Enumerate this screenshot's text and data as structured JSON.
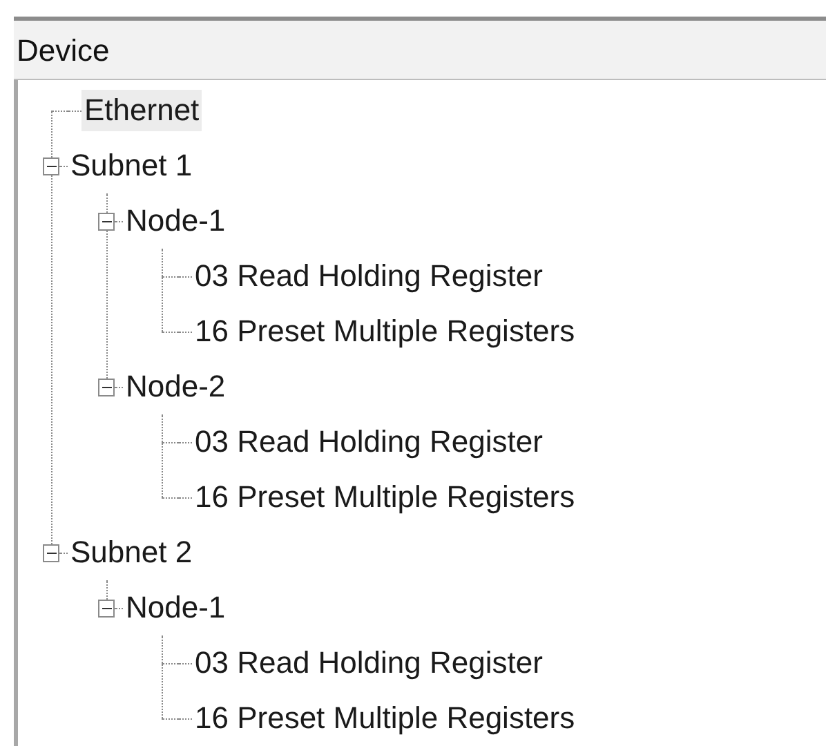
{
  "header": {
    "title": "Device"
  },
  "tree": [
    {
      "label": "Ethernet",
      "selected": true
    },
    {
      "label": "Subnet 1",
      "selected": false,
      "expanded": true,
      "children": [
        {
          "label": "Node-1",
          "selected": false,
          "expanded": true,
          "children": [
            {
              "label": "03 Read Holding Register",
              "selected": false
            },
            {
              "label": "16 Preset Multiple Registers",
              "selected": false
            }
          ]
        },
        {
          "label": "Node-2",
          "selected": false,
          "expanded": true,
          "children": [
            {
              "label": "03 Read Holding Register",
              "selected": false
            },
            {
              "label": "16 Preset Multiple Registers",
              "selected": false
            }
          ]
        }
      ]
    },
    {
      "label": "Subnet 2",
      "selected": false,
      "expanded": true,
      "children": [
        {
          "label": "Node-1",
          "selected": false,
          "expanded": true,
          "children": [
            {
              "label": "03 Read Holding Register",
              "selected": false
            },
            {
              "label": "16 Preset Multiple Registers",
              "selected": false
            }
          ]
        }
      ]
    }
  ]
}
